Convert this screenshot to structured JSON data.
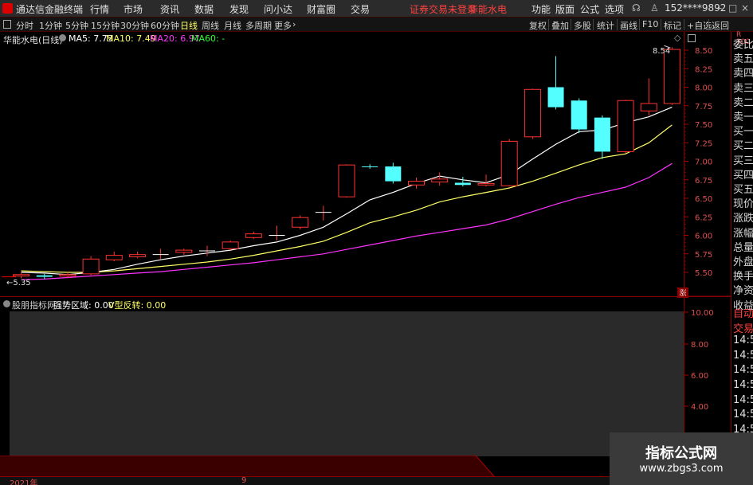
{
  "menubar": {
    "app_title": "通达信金融终端",
    "items": [
      "行情",
      "市场",
      "资讯",
      "数据",
      "发现",
      "问小达",
      "财富圈",
      "交易"
    ],
    "status": "证券交易未登录",
    "stock": "华能水电",
    "right_items": [
      "功能",
      "版面",
      "公式",
      "选项"
    ],
    "account": "152****9892"
  },
  "toolbar": {
    "periods": [
      "分时",
      "1分钟",
      "5分钟",
      "15分钟",
      "30分钟",
      "60分钟",
      "日线",
      "周线",
      "月线",
      "多周期",
      "更多"
    ],
    "active_period": "日线",
    "right_buttons": [
      "复权",
      "叠加",
      "多股",
      "统计",
      "画线",
      "F10",
      "标记",
      "+自选",
      "返回"
    ]
  },
  "main_chart": {
    "title": "华能水电(日线)",
    "ma5_label": "MA5: 7.73",
    "ma10_label": "MA10: 7.49",
    "ma20_label": "MA20: 6.97",
    "ma60_label": "MA60: -",
    "high_label": "8.54",
    "low_label": "5.35",
    "badge": "涨"
  },
  "sub_chart": {
    "title": "股朋指标网",
    "field1": "强势区域: 0.00",
    "field2": "V型反转: 0.00"
  },
  "date_axis": [
    "2021年",
    "9"
  ],
  "right_panel": {
    "price_items": [
      "委比",
      "卖五",
      "卖四",
      "卖三",
      "卖二",
      "卖一",
      "买一",
      "买二",
      "买三",
      "买四",
      "买五",
      "现价",
      "涨跌",
      "涨幅",
      "总量",
      "外盘",
      "换手",
      "净资",
      "收益"
    ],
    "lower_items": [
      "自动",
      "交易",
      "14:5",
      "14:5",
      "14:5",
      "14:5",
      "14:5",
      "14:5",
      "14:5",
      "14:5"
    ]
  },
  "watermark": {
    "title": "指标公式网",
    "url": "www.zbgs3.com"
  },
  "chart_data": {
    "type": "candlestick",
    "y_axis": [
      "8.50",
      "8.25",
      "8.00",
      "7.75",
      "7.50",
      "7.25",
      "7.00",
      "6.75",
      "6.50",
      "6.25",
      "6.00",
      "5.75",
      "5.50"
    ],
    "sub_y_axis": [
      "10.00",
      "8.00",
      "6.00",
      "4.00"
    ],
    "colors": {
      "up": "#ff3232",
      "down": "#54ffff",
      "ma5": "#ffffff",
      "ma10": "#ffff66",
      "ma20": "#ff33ff"
    },
    "candles": [
      {
        "o": 5.45,
        "c": 5.47,
        "h": 5.5,
        "l": 5.42
      },
      {
        "o": 5.46,
        "c": 5.44,
        "h": 5.48,
        "l": 5.41
      },
      {
        "o": 5.45,
        "c": 5.47,
        "h": 5.5,
        "l": 5.42
      },
      {
        "o": 5.48,
        "c": 5.68,
        "h": 5.72,
        "l": 5.46
      },
      {
        "o": 5.67,
        "c": 5.73,
        "h": 5.78,
        "l": 5.65
      },
      {
        "o": 5.71,
        "c": 5.74,
        "h": 5.78,
        "l": 5.69
      },
      {
        "o": 5.74,
        "c": 5.74,
        "h": 5.82,
        "l": 5.68
      },
      {
        "o": 5.77,
        "c": 5.8,
        "h": 5.82,
        "l": 5.74
      },
      {
        "o": 5.79,
        "c": 5.79,
        "h": 5.86,
        "l": 5.72
      },
      {
        "o": 5.82,
        "c": 5.91,
        "h": 5.93,
        "l": 5.8
      },
      {
        "o": 5.97,
        "c": 6.02,
        "h": 6.05,
        "l": 5.95
      },
      {
        "o": 6.0,
        "c": 6.0,
        "h": 6.13,
        "l": 5.93
      },
      {
        "o": 6.11,
        "c": 6.24,
        "h": 6.27,
        "l": 6.08
      },
      {
        "o": 6.31,
        "c": 6.31,
        "h": 6.4,
        "l": 6.2
      },
      {
        "o": 6.52,
        "c": 6.95,
        "h": 6.96,
        "l": 6.51
      },
      {
        "o": 6.93,
        "c": 6.92,
        "h": 6.96,
        "l": 6.9
      },
      {
        "o": 6.93,
        "c": 6.73,
        "h": 6.98,
        "l": 6.7
      },
      {
        "o": 6.68,
        "c": 6.73,
        "h": 6.78,
        "l": 6.63
      },
      {
        "o": 6.72,
        "c": 6.76,
        "h": 6.85,
        "l": 6.67
      },
      {
        "o": 6.71,
        "c": 6.68,
        "h": 6.79,
        "l": 6.66
      },
      {
        "o": 6.68,
        "c": 6.7,
        "h": 6.82,
        "l": 6.66
      },
      {
        "o": 6.67,
        "c": 7.27,
        "h": 7.3,
        "l": 6.66
      },
      {
        "o": 7.33,
        "c": 7.97,
        "h": 7.98,
        "l": 7.3
      },
      {
        "o": 8.0,
        "c": 7.73,
        "h": 8.42,
        "l": 7.7
      },
      {
        "o": 7.82,
        "c": 7.43,
        "h": 7.85,
        "l": 7.38
      },
      {
        "o": 7.59,
        "c": 7.13,
        "h": 7.62,
        "l": 7.03
      },
      {
        "o": 7.13,
        "c": 7.82,
        "h": 7.83,
        "l": 7.11
      },
      {
        "o": 7.68,
        "c": 7.78,
        "h": 8.12,
        "l": 7.62
      },
      {
        "o": 7.78,
        "c": 8.51,
        "h": 8.54,
        "l": 7.76
      }
    ],
    "ma5": [
      5.5,
      5.49,
      5.47,
      5.5,
      5.54,
      5.61,
      5.67,
      5.72,
      5.76,
      5.8,
      5.86,
      5.91,
      6.0,
      6.11,
      6.29,
      6.48,
      6.58,
      6.7,
      6.8,
      6.75,
      6.71,
      6.82,
      7.03,
      7.23,
      7.4,
      7.42,
      7.52,
      7.6,
      7.73
    ],
    "ma10": [
      5.52,
      5.51,
      5.5,
      5.5,
      5.52,
      5.55,
      5.58,
      5.61,
      5.64,
      5.68,
      5.73,
      5.79,
      5.85,
      5.92,
      6.04,
      6.17,
      6.25,
      6.34,
      6.45,
      6.52,
      6.58,
      6.64,
      6.73,
      6.84,
      6.95,
      7.05,
      7.1,
      7.25,
      7.49
    ],
    "ma20": [
      5.4,
      5.41,
      5.43,
      5.45,
      5.47,
      5.49,
      5.51,
      5.54,
      5.57,
      5.6,
      5.63,
      5.67,
      5.71,
      5.75,
      5.81,
      5.87,
      5.93,
      5.99,
      6.04,
      6.09,
      6.14,
      6.22,
      6.32,
      6.42,
      6.51,
      6.58,
      6.65,
      6.78,
      6.97
    ]
  }
}
